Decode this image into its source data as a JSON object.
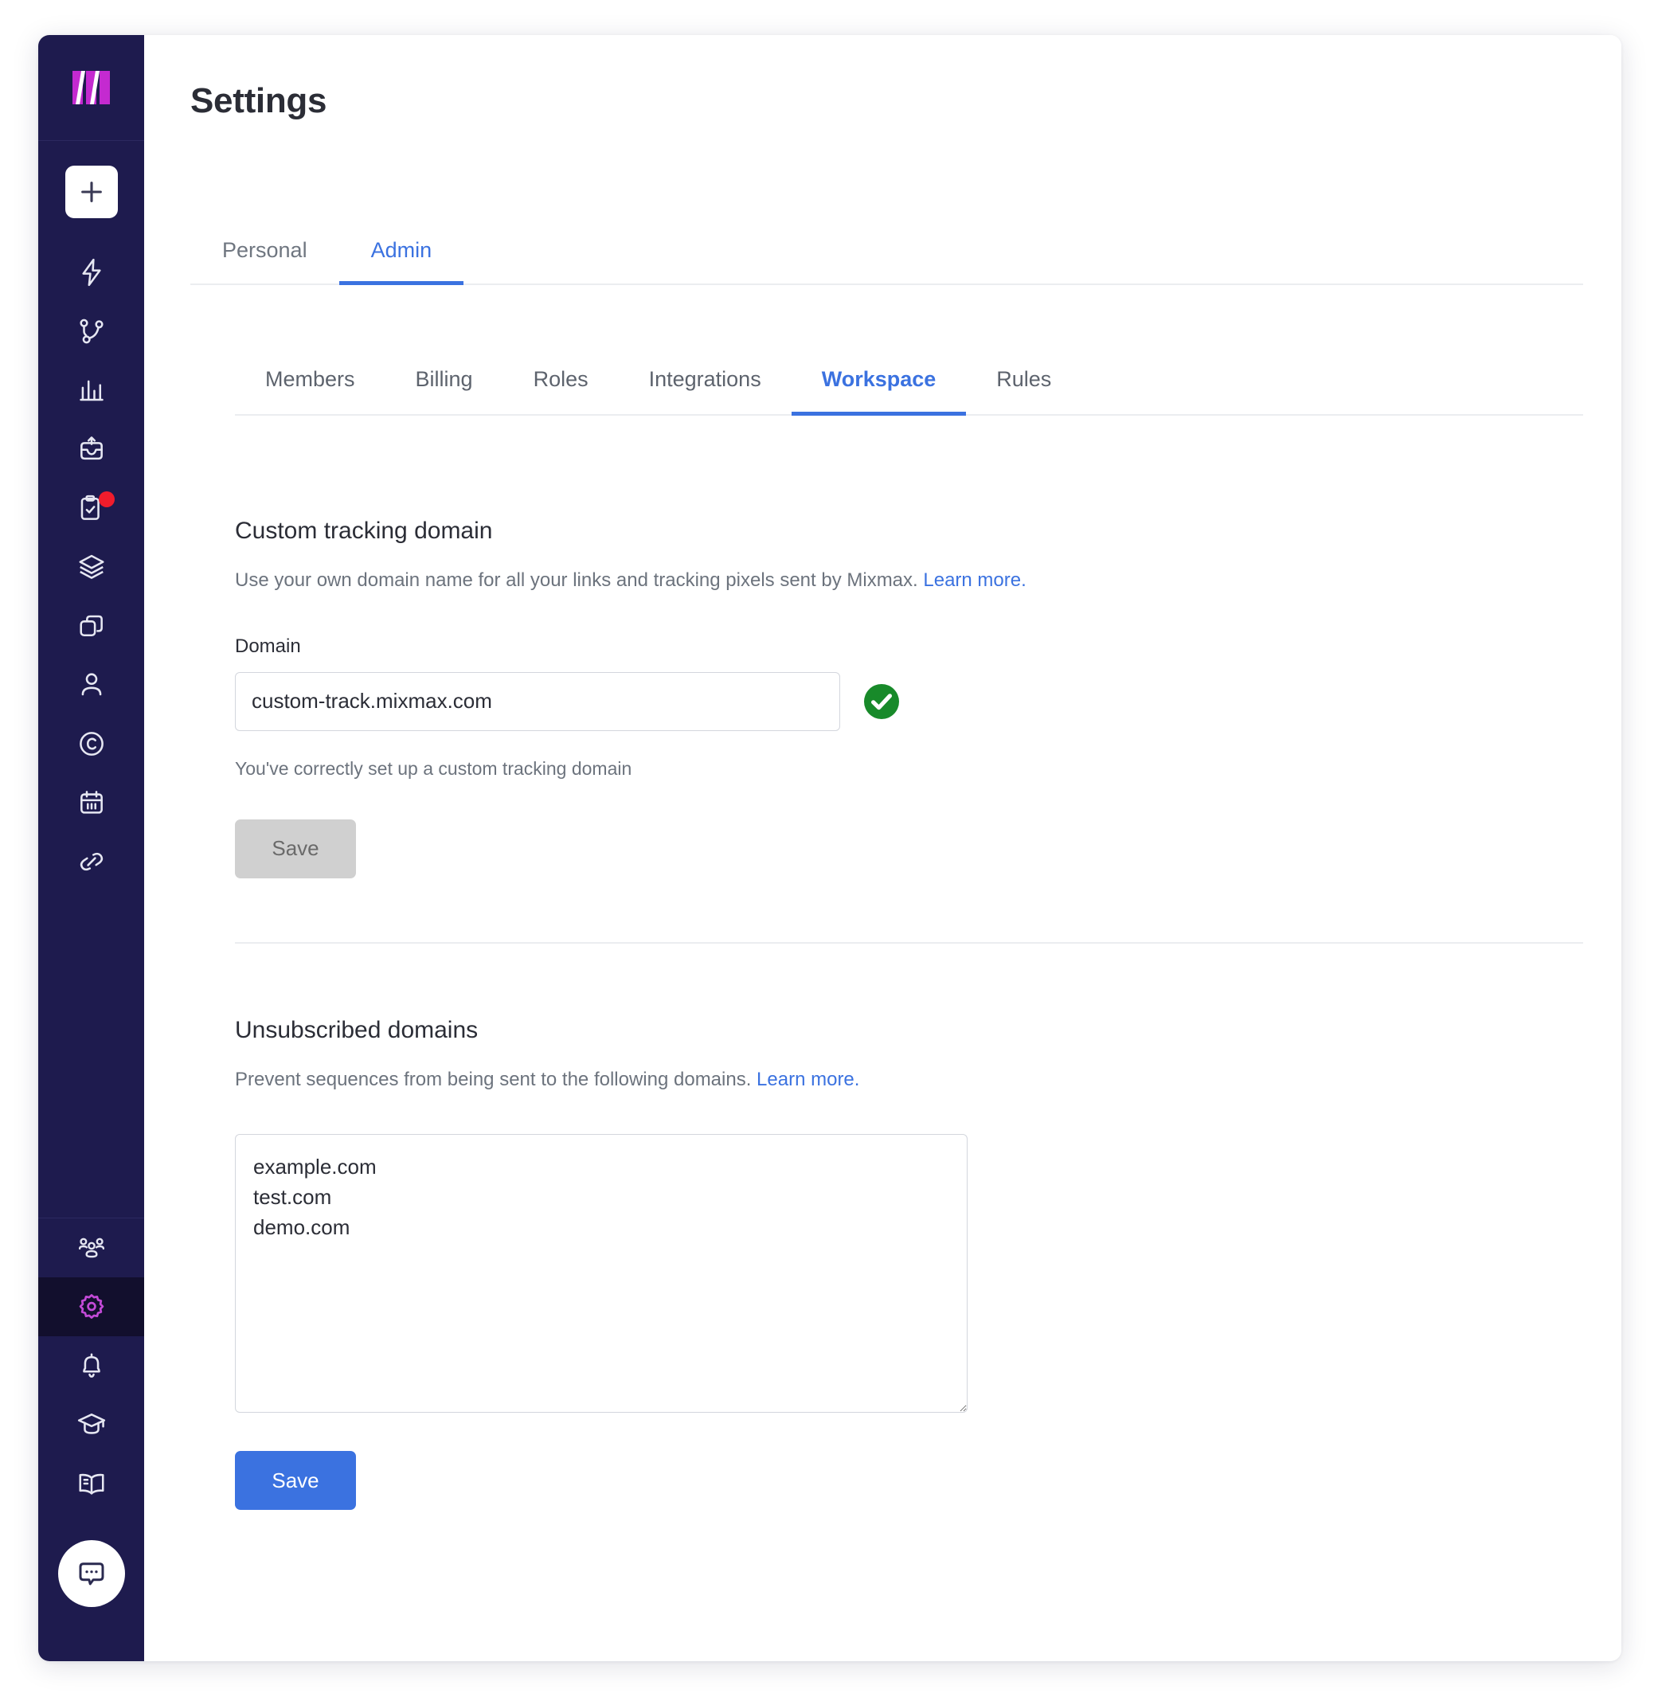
{
  "app": {
    "logo_name": "mixmax-logo",
    "brand_color": "#c42ad0",
    "sidebar_bg": "#1e1b4e",
    "accent_blue": "#3b72e0",
    "success_green": "#188a2a",
    "badge_red": "#f01c2c"
  },
  "sidebar": {
    "compose_label": "+",
    "primary_items": [
      {
        "name": "sidebar-item-automation",
        "icon": "lightning-bolt-icon"
      },
      {
        "name": "sidebar-item-sequences",
        "icon": "branch-nodes-icon"
      },
      {
        "name": "sidebar-item-reports",
        "icon": "bar-chart-icon"
      },
      {
        "name": "sidebar-item-inbox",
        "icon": "inbox-upload-icon"
      },
      {
        "name": "sidebar-item-tasks",
        "icon": "clipboard-check-icon",
        "badge": true
      },
      {
        "name": "sidebar-item-templates",
        "icon": "layers-icon"
      },
      {
        "name": "sidebar-item-snippets",
        "icon": "copy-icon"
      },
      {
        "name": "sidebar-item-contacts",
        "icon": "person-icon"
      },
      {
        "name": "sidebar-item-crm",
        "icon": "circle-c-icon"
      },
      {
        "name": "sidebar-item-calendar",
        "icon": "calendar-icon"
      },
      {
        "name": "sidebar-item-links",
        "icon": "link-icon"
      }
    ],
    "secondary_items": [
      {
        "name": "sidebar-item-team",
        "icon": "people-group-icon",
        "active": false
      },
      {
        "name": "sidebar-item-settings",
        "icon": "gear-icon",
        "active": true
      },
      {
        "name": "sidebar-item-notifications",
        "icon": "bell-icon",
        "active": false
      },
      {
        "name": "sidebar-item-academy",
        "icon": "graduation-cap-icon",
        "active": false
      },
      {
        "name": "sidebar-item-docs",
        "icon": "open-book-icon",
        "active": false
      }
    ],
    "chat_icon": "chat-bubble-icon"
  },
  "header": {
    "title": "Settings"
  },
  "top_tabs": [
    {
      "label": "Personal",
      "active": false
    },
    {
      "label": "Admin",
      "active": true
    }
  ],
  "sub_tabs": [
    {
      "label": "Members",
      "active": false
    },
    {
      "label": "Billing",
      "active": false
    },
    {
      "label": "Roles",
      "active": false
    },
    {
      "label": "Integrations",
      "active": false
    },
    {
      "label": "Workspace",
      "active": true
    },
    {
      "label": "Rules",
      "active": false
    }
  ],
  "tracking_domain": {
    "title": "Custom tracking domain",
    "description": "Use your own domain name for all your links and tracking pixels sent by Mixmax.",
    "learn_more": "Learn more.",
    "field_label": "Domain",
    "value": "custom-track.mixmax.com",
    "placeholder": "",
    "status_icon": "green-check-circle-icon",
    "helper_text": "You've correctly set up a custom tracking domain",
    "save_label": "Save",
    "save_disabled": true
  },
  "unsubscribed_domains": {
    "title": "Unsubscribed domains",
    "description": "Prevent sequences from being sent to the following domains.",
    "learn_more": "Learn more.",
    "value": "example.com\ntest.com\ndemo.com",
    "placeholder": "",
    "save_label": "Save"
  }
}
